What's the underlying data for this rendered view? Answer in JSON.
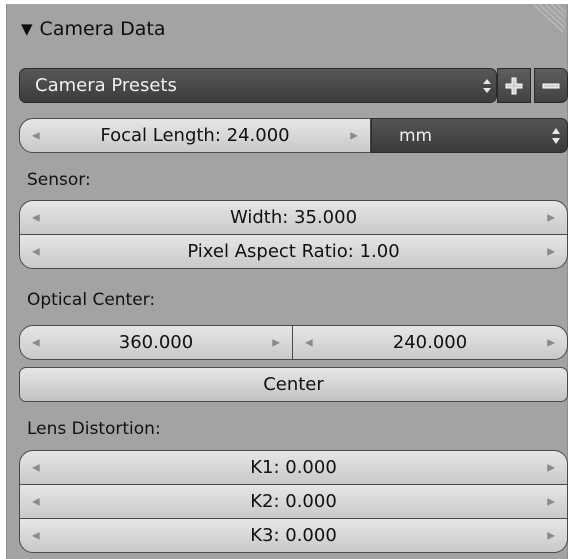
{
  "panel": {
    "title": "Camera Data",
    "presets": {
      "label": "Camera Presets"
    },
    "focal_length": {
      "label": "Focal Length: 24.000",
      "unit": "mm"
    },
    "sensor": {
      "label": "Sensor:",
      "width": "Width: 35.000",
      "pixel_aspect_ratio": "Pixel Aspect Ratio: 1.00"
    },
    "optical_center": {
      "label": "Optical Center:",
      "x": "360.000",
      "y": "240.000",
      "center_button": "Center"
    },
    "lens_distortion": {
      "label": "Lens Distortion:",
      "k1": "K1: 0.000",
      "k2": "K2: 0.000",
      "k3": "K3: 0.000"
    }
  },
  "icons": {
    "collapse": "triangle-down-icon",
    "preset_updown": "updown-arrows-icon",
    "add": "plus-icon",
    "remove": "minus-icon",
    "decrement": "arrow-left-icon",
    "increment": "arrow-right-icon",
    "grip": "resize-grip-icon"
  },
  "colors": {
    "panel_bg": "#a3a3a3",
    "field_bg": "#d8d8d8",
    "dark_widget": "#4a4a4a"
  }
}
